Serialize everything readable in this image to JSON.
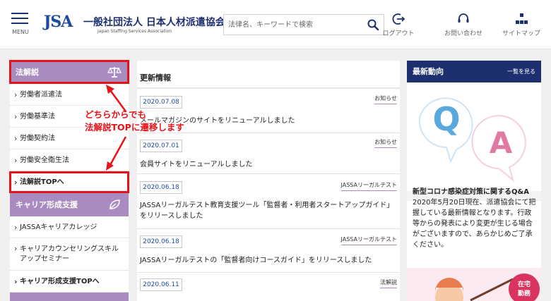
{
  "header": {
    "menu_label": "MENU",
    "logo_mark": "JSA",
    "logo_name_jp": "一般社団法人 日本人材派遣協会",
    "logo_name_en": "Japan Staffing Services Association",
    "search_placeholder": "法律名、キーワードで検索",
    "nav": [
      {
        "label": "ログアウト",
        "icon": "logout-icon"
      },
      {
        "label": "お問い合わせ",
        "icon": "headset-icon"
      },
      {
        "label": "サイトマップ",
        "icon": "sitemap-icon"
      }
    ]
  },
  "sidebar": {
    "section1": {
      "title": "法解説",
      "icon": "scales-icon",
      "items": [
        "労働者派遣法",
        "労働基準法",
        "労働契約法",
        "労働安全衛生法",
        "法解説TOPへ"
      ]
    },
    "section2": {
      "title": "キャリア形成支援",
      "icon": "leaf-icon",
      "items": [
        "JASSAキャリアカレッジ",
        "キャリアカウンセリングスキル",
        "アップセミナー",
        "キャリア形成支援TOPへ"
      ]
    }
  },
  "annotation": {
    "line1": "どちらからでも",
    "line2": "法解説TOPに遷移します",
    "color": "#e8121a"
  },
  "news": {
    "title": "更新情報",
    "items": [
      {
        "date": "2020.07.08",
        "tag": "お知らせ",
        "text": "メールマガジンのサイトをリニューアルしました"
      },
      {
        "date": "2020.07.01",
        "tag": "お知らせ",
        "text": "会員サイトをリニューアルしました"
      },
      {
        "date": "2020.06.18",
        "tag": "JASSAリーガルテスト",
        "text": "JASSAリーガルテスト教育支援ツール「監督者・利用者スタートアップガイド」をリリースしました"
      },
      {
        "date": "2020.06.18",
        "tag": "JASSAリーガルテスト",
        "text": "JASSAリーガルテストの「監督者向けコースガイド」をリリースしました"
      },
      {
        "date": "2020.06.11",
        "tag": "法解説",
        "text": ""
      }
    ]
  },
  "right": {
    "title": "最新動向",
    "more": "一覧を見る",
    "q_letter": "Q",
    "a_letter": "A",
    "article_title": "新型コロナ感染症対策に関するQ&A",
    "article_text": "2020年5月20日現在、派遣協会にて把握している最新情報となります。行政等からの発表により変更が生じる場合がございますので、あらかじめご了承ください。",
    "badge_line1": "在宅",
    "badge_line2": "勤務"
  },
  "colors": {
    "navy": "#1d2f6f",
    "purple": "#a98cbf",
    "highlight": "#e8121a",
    "q_bubble": "#5aa9dd",
    "a_bubble": "#e07aa3"
  }
}
